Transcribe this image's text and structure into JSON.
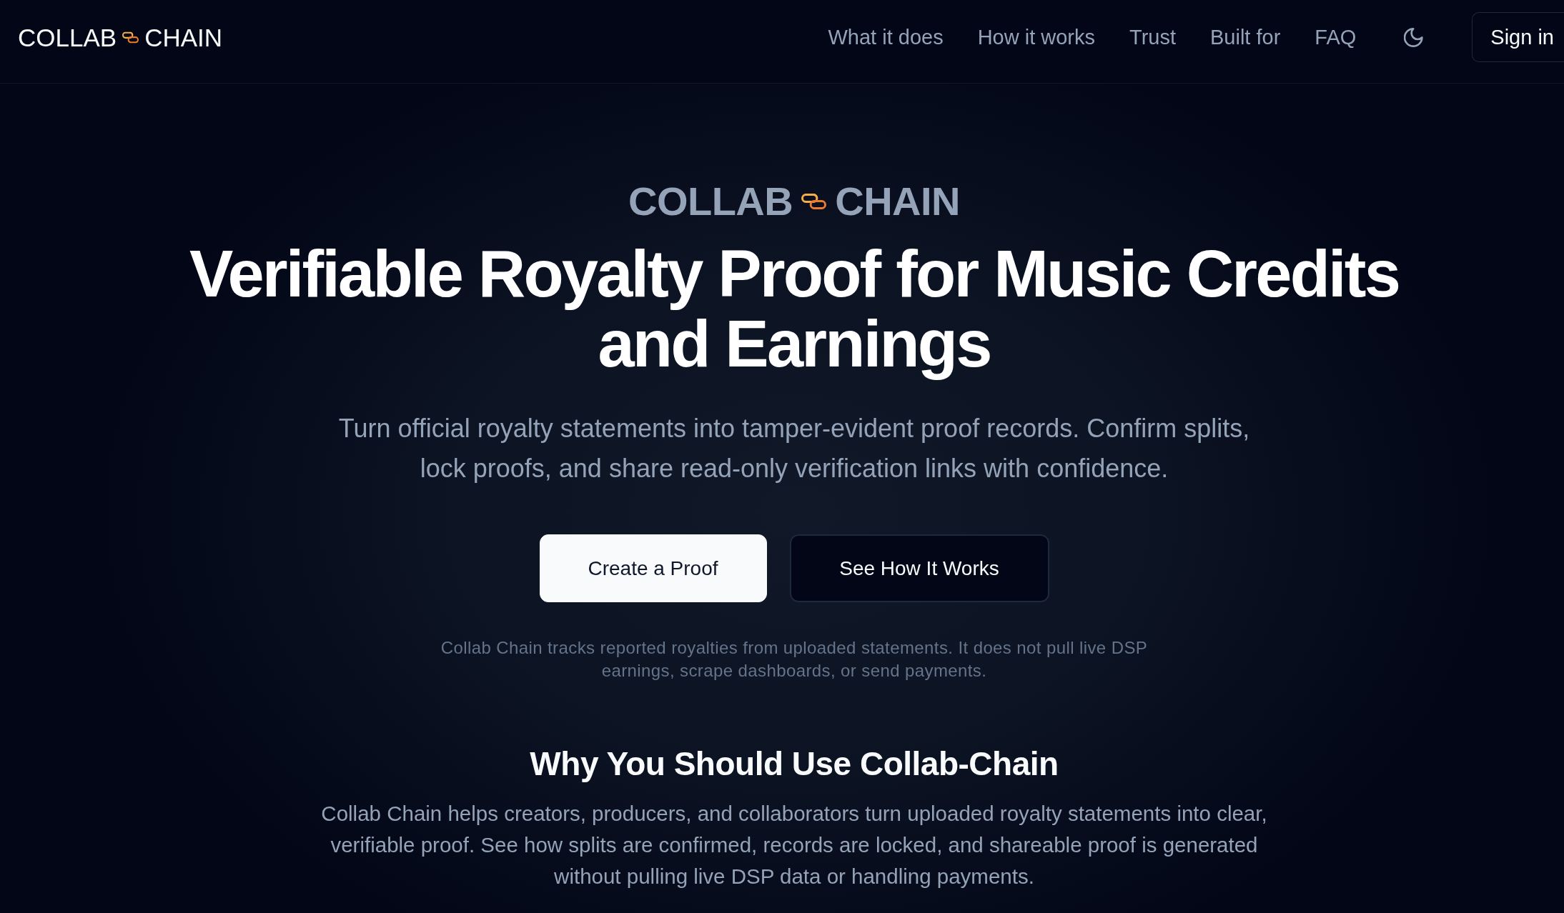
{
  "header": {
    "logo": {
      "left": "COLLAB",
      "right": "CHAIN"
    },
    "nav_links": [
      "What it does",
      "How it works",
      "Trust",
      "Built for",
      "FAQ"
    ],
    "sign_in": "Sign in"
  },
  "hero": {
    "brand": {
      "left": "COLLAB",
      "right": "CHAIN"
    },
    "title": "Verifiable Royalty Proof for Music Credits and Earnings",
    "subtitle": "Turn official royalty statements into tamper-evident proof records. Confirm splits, lock proofs, and share read-only verification links with confidence.",
    "buttons": [
      {
        "label": "Create a Proof",
        "kind": "primary"
      },
      {
        "label": "See How It Works",
        "kind": "secondary"
      }
    ],
    "disclaimer": "Collab Chain tracks reported royalties from uploaded statements. It does not pull live DSP earnings, scrape dashboards, or send payments."
  },
  "why": {
    "heading": "Why You Should Use Collab-Chain",
    "body": "Collab Chain helps creators, producers, and collaborators turn uploaded royalty statements into clear, verifiable proof. See how splits are confirmed, records are locked, and shareable proof is generated without pulling live DSP data or handling payments."
  }
}
